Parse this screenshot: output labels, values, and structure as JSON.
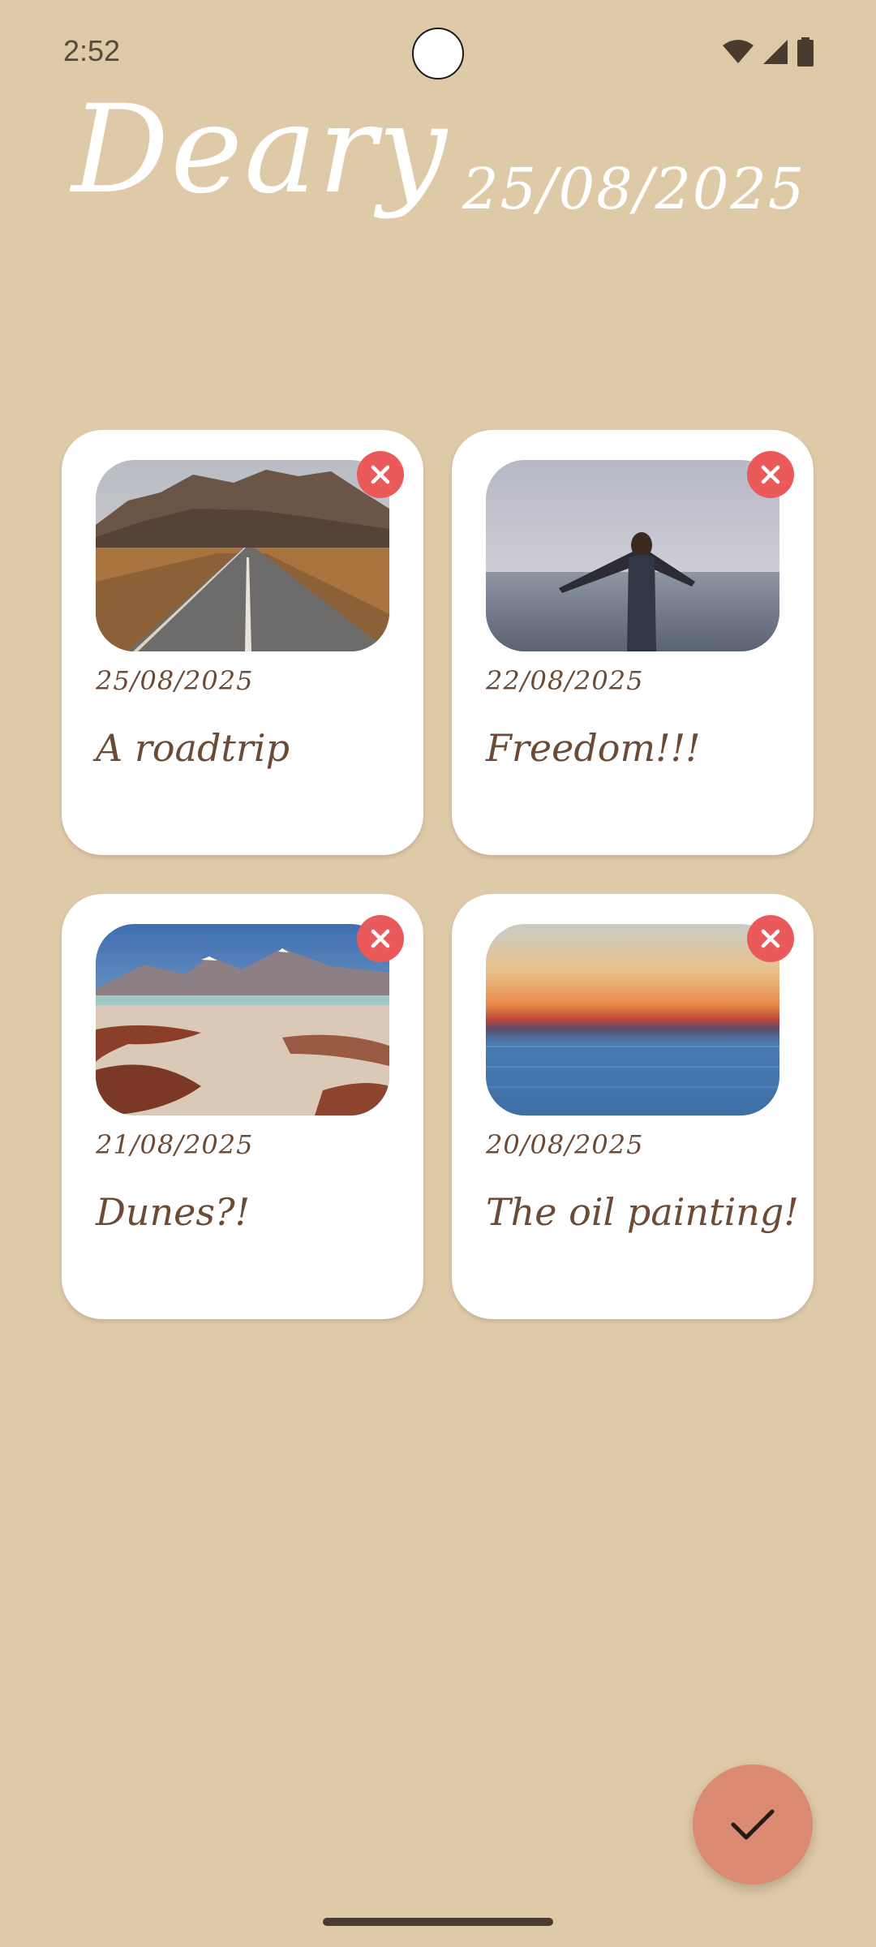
{
  "status_bar": {
    "time": "2:52",
    "icons": [
      "wifi-icon",
      "cellular-signal-icon",
      "battery-icon"
    ]
  },
  "header": {
    "app_title": "Deary",
    "current_date": "25/08/2025"
  },
  "entries": [
    {
      "date": "25/08/2025",
      "title": "A roadtrip",
      "image": "mountain-road-photo"
    },
    {
      "date": "22/08/2025",
      "title": "Freedom!!!",
      "image": "person-in-sea-photo"
    },
    {
      "date": "21/08/2025",
      "title": "Dunes?!",
      "image": "desert-landscape-photo"
    },
    {
      "date": "20/08/2025",
      "title": "The oil painting!",
      "image": "sunset-ocean-photo"
    }
  ],
  "fab": {
    "icon": "check-icon"
  },
  "colors": {
    "background": "#dfcaa8",
    "card": "#ffffff",
    "text_brown": "#6b4b35",
    "delete_red": "#ea5a5a",
    "fab": "#db8a72"
  }
}
